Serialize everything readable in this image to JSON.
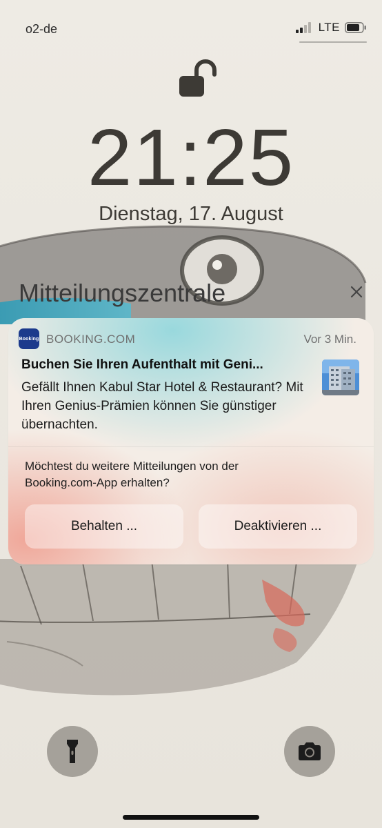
{
  "status_bar": {
    "carrier": "o2-de",
    "network_type": "LTE",
    "signal_icon": "signal-bars-icon",
    "battery_icon": "battery-icon"
  },
  "lock_screen": {
    "lock_icon": "unlocked-padlock-icon",
    "time": "21:25",
    "date": "Dienstag, 17. August"
  },
  "notification_center": {
    "title": "Mitteilungszentrale",
    "close_icon": "close-icon"
  },
  "notification": {
    "app_icon_text": "Booking",
    "app_name": "BOOKING.COM",
    "time": "Vor 3 Min.",
    "title": "Buchen Sie Ihren Aufenthalt mit Geni...",
    "body": "Gefällt Ihnen Kabul Star Hotel & Restaurant? Mit Ihren Genius-Prämien können Sie günstiger übernachten.",
    "prompt": "Möchtest du weitere Mitteilungen von der Booking.com-App erhalten?",
    "keep_label": "Behalten ...",
    "deactivate_label": "Deaktivieren ..."
  },
  "quick_actions": {
    "flashlight_icon": "flashlight-icon",
    "camera_icon": "camera-icon"
  },
  "colors": {
    "brand": "#1c3a8c",
    "clock_text": "#3d3a35"
  }
}
